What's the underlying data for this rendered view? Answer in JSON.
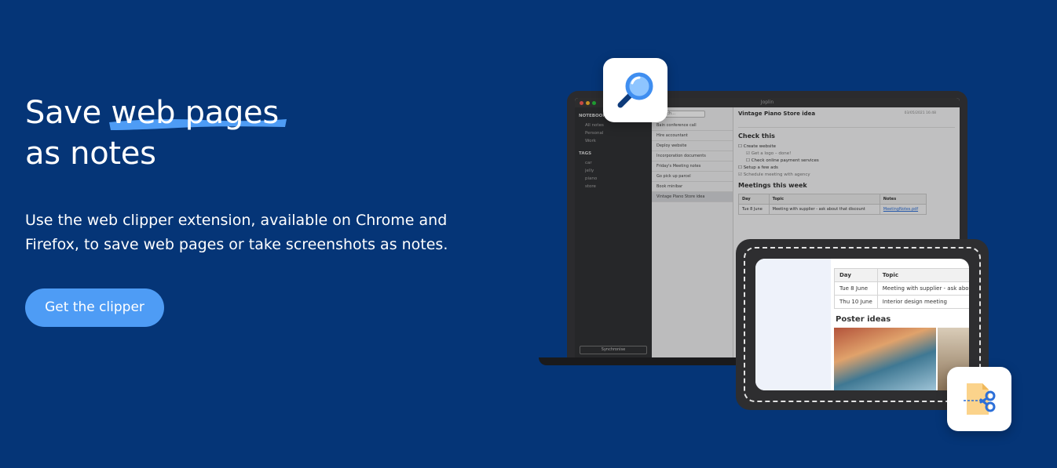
{
  "hero": {
    "headline_line1_a": "Save ",
    "headline_highlight": "web pages",
    "headline_line2": "as notes",
    "description": "Use the web clipper extension, available on Chrome and Firefox, to save web pages or take screenshots as notes.",
    "cta_label": "Get the clipper"
  },
  "colors": {
    "background": "#053577",
    "accent": "#4e9cf5"
  },
  "laptop_app": {
    "window_title": "Joplin",
    "sidebar": {
      "notebooks_header": "NOTEBOOKS",
      "notebooks": [
        "All notes",
        "Personal",
        "Work"
      ],
      "tags_header": "TAGS",
      "tags": [
        "car",
        "jelly",
        "piano",
        "store"
      ],
      "sync_label": "Synchronise"
    },
    "search_placeholder": "Search...",
    "notes": [
      "Bain conference call",
      "Hire accountant",
      "Deploy website",
      "Incorporation documents",
      "Friday's Meeting notes",
      "Go pick up parcel",
      "Book minibar",
      "Vintage Piano Store idea"
    ],
    "editor": {
      "title": "Vintage Piano Store idea",
      "date": "03/05/2021 16:48",
      "heading_check": "Check this",
      "checklist": [
        {
          "text": "Create website",
          "indent": false,
          "done": false
        },
        {
          "text": "Get a logo – done!",
          "indent": true,
          "done": true
        },
        {
          "text": "Check online payment services",
          "indent": true,
          "done": false
        },
        {
          "text": "Setup a few ads",
          "indent": false,
          "done": false
        },
        {
          "text": "Schedule meeting with agency",
          "indent": false,
          "done": true
        }
      ],
      "heading_meetings": "Meetings this week",
      "table_headers": [
        "Day",
        "Topic",
        "Notes"
      ],
      "table_rows": [
        [
          "Tue 8 June",
          "Meeting with supplier - ask about that discount",
          "MeetingNotes.pdf"
        ]
      ]
    }
  },
  "tablet_app": {
    "table_headers": [
      "Day",
      "Topic"
    ],
    "table_rows": [
      [
        "Tue 8 June",
        "Meeting with supplier - ask about that disco"
      ],
      [
        "Thu 10 June",
        "Interior design meeting"
      ]
    ],
    "heading": "Poster ideas"
  },
  "icons": {
    "search_badge": "magnifier-icon",
    "clip_badge": "scissors-document-icon"
  }
}
